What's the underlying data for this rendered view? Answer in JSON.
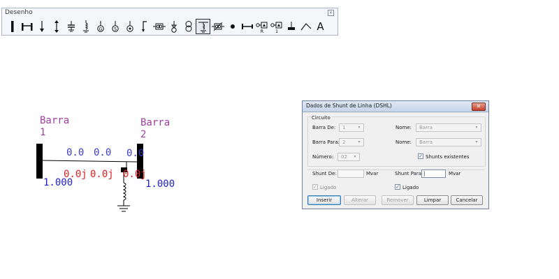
{
  "toolbar": {
    "title": "Desenho",
    "pin_icon": "pin-icon",
    "tools": [
      {
        "name": "barra-icon"
      },
      {
        "name": "linha-icon"
      },
      {
        "name": "carga-icon"
      },
      {
        "name": "gerador-vertical-icon"
      },
      {
        "name": "capacitor-icon"
      },
      {
        "name": "reator-icon"
      },
      {
        "name": "gerador-icon"
      },
      {
        "name": "motor-icon"
      },
      {
        "name": "compensador-icon"
      },
      {
        "name": "elo-icon"
      },
      {
        "name": "transformador-icon"
      },
      {
        "name": "fonte-icon"
      },
      {
        "name": "transformador-tres-enrolamentos-icon"
      },
      {
        "name": "shunt-linha-icon",
        "active": true
      },
      {
        "name": "transformador-defasador-icon"
      },
      {
        "name": "ponto-icon"
      },
      {
        "name": "chave-icon"
      },
      {
        "name": "medidor-r-icon",
        "label": "R"
      },
      {
        "name": "medidor-1-icon",
        "label": "1"
      },
      {
        "name": "aterramento-icon"
      },
      {
        "name": "linha-quebrada-icon"
      },
      {
        "name": "texto-icon",
        "label": "A"
      }
    ]
  },
  "diagram": {
    "bus1": {
      "name": "Barra",
      "number": "1",
      "voltage": "1.000"
    },
    "bus2": {
      "name": "Barra",
      "number": "2",
      "voltage": "1.000"
    },
    "flow_p": [
      "0.0",
      "0.0",
      "0.0"
    ],
    "flow_q": [
      "0.0j",
      "0.0j",
      "0.0j"
    ]
  },
  "dialog": {
    "title": "Dados de Shunt de Linha (DSHL)",
    "group_title": "Circuito",
    "barra_de_label": "Barra De:",
    "barra_de_value": "1",
    "barra_para_label": "Barra Para:",
    "barra_para_value": "2",
    "nome_label": "Nome:",
    "nome_de_value": "Barra",
    "nome_para_value": "Barra",
    "numero_label": "Número:",
    "numero_value": "02",
    "shunts_existentes_label": "Shunts existentes",
    "shunts_existentes_checked": true,
    "shunt_de_label": "Shunt De:",
    "shunt_de_unit": "Mvar",
    "shunt_para_label": "Shunt Para:",
    "shunt_para_unit": "Mvar",
    "ligado_de_label": "Ligado",
    "ligado_para_label": "Ligado",
    "buttons": {
      "inserir": "Inserir",
      "alterar": "Alterar",
      "remover": "Remover",
      "limpar": "Limpar",
      "cancelar": "Cancelar"
    }
  },
  "colors": {
    "bus_label": "#a040a0",
    "voltage": "#2020d0",
    "flow_p": "#3a3ad0",
    "flow_q": "#e02020",
    "bus_bar": "#000000"
  }
}
